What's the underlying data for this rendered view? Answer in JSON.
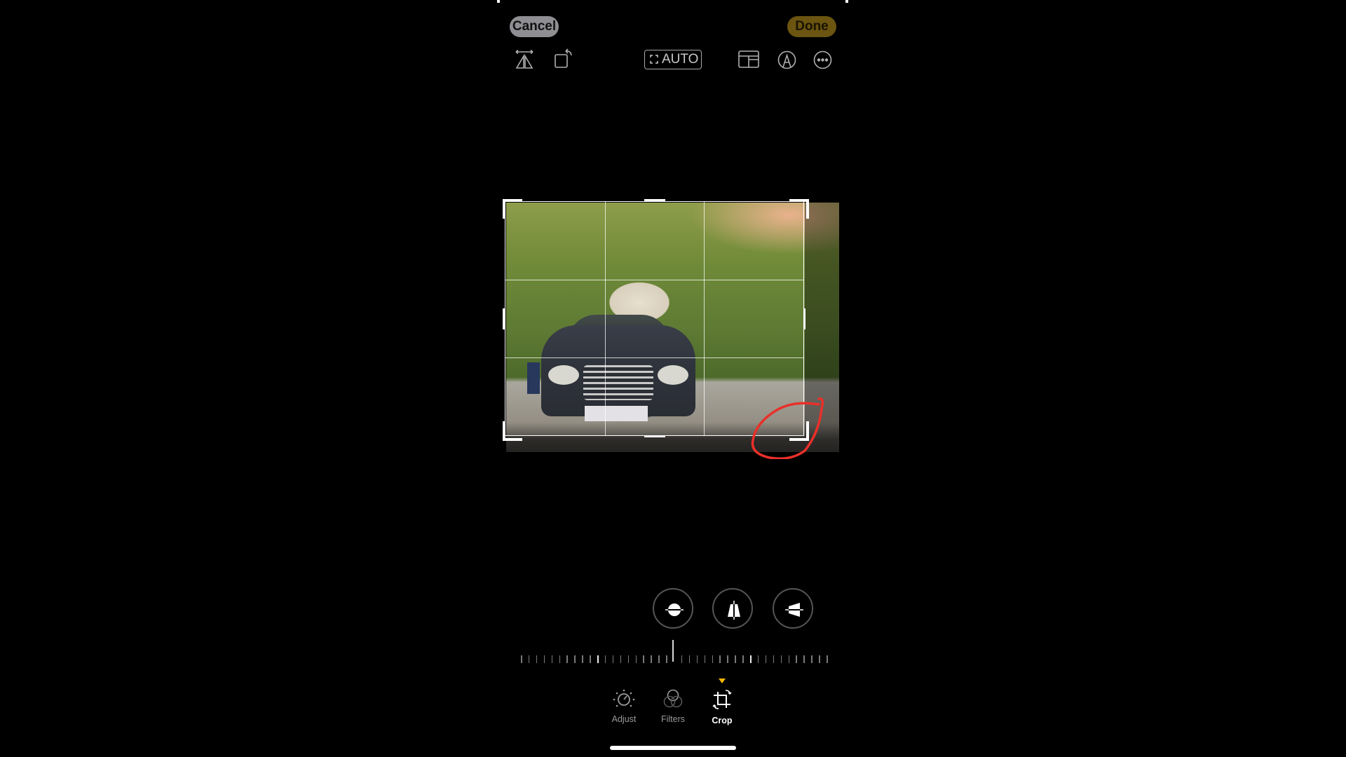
{
  "header": {
    "cancel_label": "Cancel",
    "done_label": "Done"
  },
  "toolbar": {
    "left_icons": [
      "flip-horizontal-icon",
      "rotate-icon"
    ],
    "auto_label": "AUTO",
    "right_icons": [
      "aspect-ratio-icon",
      "markup-icon",
      "more-icon"
    ]
  },
  "editor": {
    "photo_description": "Dark Mercedes sedan parked under a vine-covered pergola",
    "crop_grid": "3x3",
    "annotation": "red hand-drawn circle around bottom-right crop handle"
  },
  "adjust_tools": [
    {
      "name": "straighten",
      "icon": "straighten-icon"
    },
    {
      "name": "vertical-perspective",
      "icon": "vertical-perspective-icon"
    },
    {
      "name": "horizontal-perspective",
      "icon": "horizontal-perspective-icon"
    }
  ],
  "ruler": {
    "value": 0
  },
  "tabs": [
    {
      "label": "Adjust",
      "icon": "adjust-dial-icon",
      "active": false
    },
    {
      "label": "Filters",
      "icon": "filters-circles-icon",
      "active": false
    },
    {
      "label": "Crop",
      "icon": "crop-icon",
      "active": true
    }
  ],
  "colors": {
    "done_bg": "#6b5510",
    "cancel_bg": "#8e8e93",
    "active_marker": "#f5b400",
    "annotation": "#e8302a"
  }
}
